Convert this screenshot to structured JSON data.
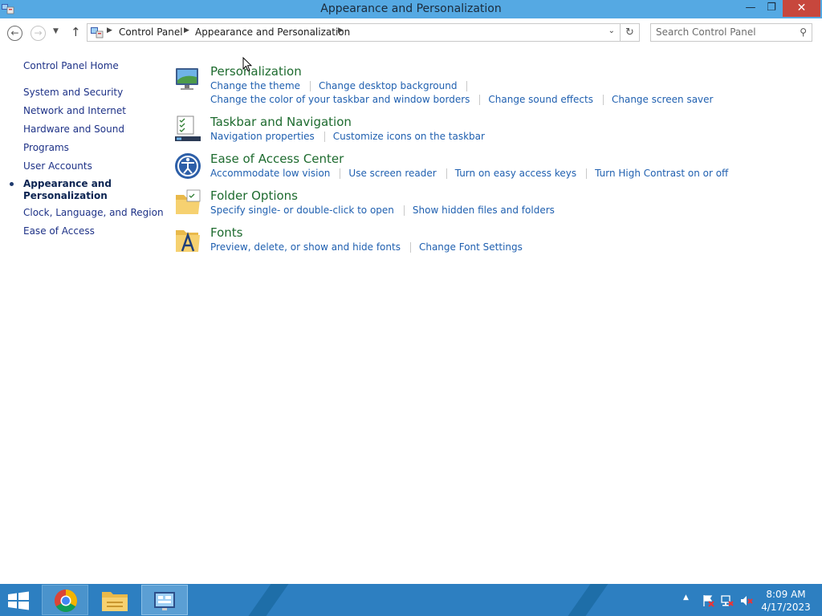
{
  "window": {
    "title": "Appearance and Personalization",
    "minimize_label": "—",
    "maximize_label": "❐",
    "close_label": "✕"
  },
  "navbar": {
    "back_glyph": "←",
    "forward_glyph": "→",
    "recent_glyph": "▼",
    "up_glyph": "↑",
    "breadcrumbs": [
      "Control Panel",
      "Appearance and Personalization"
    ],
    "dropdown_glyph": "⌄",
    "refresh_glyph": "↻",
    "search_placeholder": "Search Control Panel"
  },
  "sidebar": {
    "home": "Control Panel Home",
    "items": [
      "System and Security",
      "Network and Internet",
      "Hardware and Sound",
      "Programs",
      "User Accounts",
      "Appearance and Personalization",
      "Clock, Language, and Region",
      "Ease of Access"
    ],
    "current_index": 5
  },
  "categories": [
    {
      "title": "Personalization",
      "icon": "personalization-icon",
      "links": [
        [
          "Change the theme",
          "Change desktop background"
        ],
        [
          "Change the color of your taskbar and window borders",
          "Change sound effects",
          "Change screen saver"
        ]
      ]
    },
    {
      "title": "Taskbar and Navigation",
      "icon": "taskbar-icon",
      "links": [
        [
          "Navigation properties",
          "Customize icons on the taskbar"
        ]
      ]
    },
    {
      "title": "Ease of Access Center",
      "icon": "ease-of-access-icon",
      "links": [
        [
          "Accommodate low vision",
          "Use screen reader",
          "Turn on easy access keys",
          "Turn High Contrast on or off"
        ]
      ]
    },
    {
      "title": "Folder Options",
      "icon": "folder-options-icon",
      "links": [
        [
          "Specify single- or double-click to open",
          "Show hidden files and folders"
        ]
      ]
    },
    {
      "title": "Fonts",
      "icon": "fonts-icon",
      "links": [
        [
          "Preview, delete, or show and hide fonts",
          "Change Font Settings"
        ]
      ]
    }
  ],
  "taskbar": {
    "apps": [
      "Google Chrome",
      "File Explorer",
      "Control Panel"
    ],
    "tray_chevron": "▲",
    "time": "8:09 AM",
    "date": "4/17/2023"
  }
}
